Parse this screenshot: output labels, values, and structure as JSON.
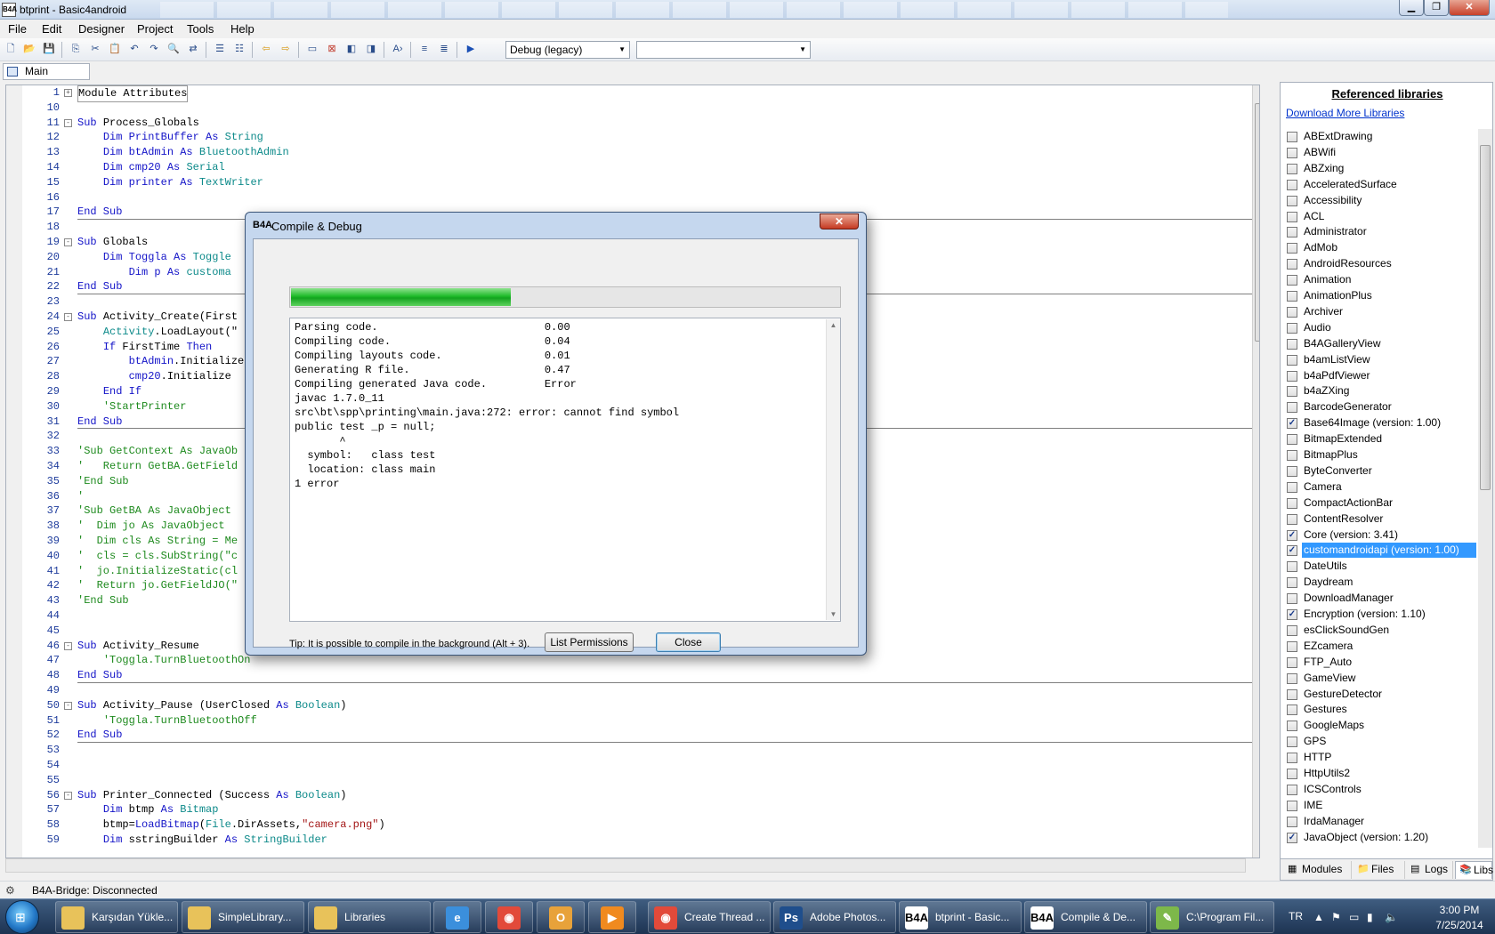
{
  "window": {
    "title": "btprint - Basic4android",
    "app_icon": "B4A"
  },
  "menu": [
    "File",
    "Edit",
    "Designer",
    "Project",
    "Tools",
    "Help"
  ],
  "toolbar": {
    "build_config": "Debug (legacy)",
    "device_combo": ""
  },
  "module_tab": "Main",
  "code": [
    {
      "n": "1",
      "tokens": [
        {
          "c": "plain",
          "t": "Module Attributes"
        }
      ],
      "fold": "+",
      "boxed": true
    },
    {
      "n": "10",
      "tokens": []
    },
    {
      "n": "11",
      "tokens": [
        {
          "c": "kw",
          "t": "Sub "
        },
        {
          "c": "plain",
          "t": "Process_Globals"
        }
      ],
      "fold": "-"
    },
    {
      "n": "12",
      "tokens": [
        {
          "c": "plain",
          "t": "    "
        },
        {
          "c": "kw",
          "t": "Dim "
        },
        {
          "c": "nm",
          "t": "PrintBuffer "
        },
        {
          "c": "kw",
          "t": "As "
        },
        {
          "c": "ty",
          "t": "String"
        }
      ]
    },
    {
      "n": "13",
      "tokens": [
        {
          "c": "plain",
          "t": "    "
        },
        {
          "c": "kw",
          "t": "Dim "
        },
        {
          "c": "nm",
          "t": "btAdmin "
        },
        {
          "c": "kw",
          "t": "As "
        },
        {
          "c": "ty",
          "t": "BluetoothAdmin"
        }
      ]
    },
    {
      "n": "14",
      "tokens": [
        {
          "c": "plain",
          "t": "    "
        },
        {
          "c": "kw",
          "t": "Dim "
        },
        {
          "c": "nm",
          "t": "cmp20 "
        },
        {
          "c": "kw",
          "t": "As "
        },
        {
          "c": "ty",
          "t": "Serial"
        }
      ]
    },
    {
      "n": "15",
      "tokens": [
        {
          "c": "plain",
          "t": "    "
        },
        {
          "c": "kw",
          "t": "Dim "
        },
        {
          "c": "nm",
          "t": "printer "
        },
        {
          "c": "kw",
          "t": "As "
        },
        {
          "c": "ty",
          "t": "TextWriter"
        }
      ]
    },
    {
      "n": "16",
      "tokens": []
    },
    {
      "n": "17",
      "tokens": [
        {
          "c": "kw",
          "t": "End Sub"
        }
      ]
    },
    {
      "n": "18",
      "tokens": []
    },
    {
      "n": "19",
      "tokens": [
        {
          "c": "kw",
          "t": "Sub "
        },
        {
          "c": "plain",
          "t": "Globals"
        }
      ],
      "fold": "-"
    },
    {
      "n": "20",
      "tokens": [
        {
          "c": "plain",
          "t": "    "
        },
        {
          "c": "kw",
          "t": "Dim "
        },
        {
          "c": "nm",
          "t": "Toggla "
        },
        {
          "c": "kw",
          "t": "As "
        },
        {
          "c": "ty",
          "t": "Toggle"
        }
      ]
    },
    {
      "n": "21",
      "tokens": [
        {
          "c": "plain",
          "t": "        "
        },
        {
          "c": "kw",
          "t": "Dim "
        },
        {
          "c": "nm",
          "t": "p "
        },
        {
          "c": "kw",
          "t": "As "
        },
        {
          "c": "ty",
          "t": "customa"
        }
      ]
    },
    {
      "n": "22",
      "tokens": [
        {
          "c": "kw",
          "t": "End Sub"
        }
      ]
    },
    {
      "n": "23",
      "tokens": []
    },
    {
      "n": "24",
      "tokens": [
        {
          "c": "kw",
          "t": "Sub "
        },
        {
          "c": "plain",
          "t": "Activity_Create(First"
        }
      ],
      "fold": "-"
    },
    {
      "n": "25",
      "tokens": [
        {
          "c": "plain",
          "t": "    "
        },
        {
          "c": "ty",
          "t": "Activity"
        },
        {
          "c": "plain",
          "t": ".LoadLayout(\""
        }
      ]
    },
    {
      "n": "26",
      "tokens": [
        {
          "c": "plain",
          "t": "    "
        },
        {
          "c": "kw",
          "t": "If "
        },
        {
          "c": "plain",
          "t": "FirstTime "
        },
        {
          "c": "kw",
          "t": "Then"
        }
      ]
    },
    {
      "n": "27",
      "tokens": [
        {
          "c": "plain",
          "t": "        "
        },
        {
          "c": "nm",
          "t": "btAdmin"
        },
        {
          "c": "plain",
          "t": ".Initialize"
        }
      ]
    },
    {
      "n": "28",
      "tokens": [
        {
          "c": "plain",
          "t": "        "
        },
        {
          "c": "nm",
          "t": "cmp20"
        },
        {
          "c": "plain",
          "t": ".Initialize"
        }
      ]
    },
    {
      "n": "29",
      "tokens": [
        {
          "c": "plain",
          "t": "    "
        },
        {
          "c": "kw",
          "t": "End If"
        }
      ]
    },
    {
      "n": "30",
      "tokens": [
        {
          "c": "plain",
          "t": "    "
        },
        {
          "c": "cm",
          "t": "'StartPrinter"
        }
      ]
    },
    {
      "n": "31",
      "tokens": [
        {
          "c": "kw",
          "t": "End Sub"
        }
      ]
    },
    {
      "n": "32",
      "tokens": []
    },
    {
      "n": "33",
      "tokens": [
        {
          "c": "cm",
          "t": "'Sub GetContext As JavaOb"
        }
      ]
    },
    {
      "n": "34",
      "tokens": [
        {
          "c": "cm",
          "t": "'   Return GetBA.GetField"
        }
      ]
    },
    {
      "n": "35",
      "tokens": [
        {
          "c": "cm",
          "t": "'End Sub"
        }
      ]
    },
    {
      "n": "36",
      "tokens": [
        {
          "c": "cm",
          "t": "'"
        }
      ]
    },
    {
      "n": "37",
      "tokens": [
        {
          "c": "cm",
          "t": "'Sub GetBA As JavaObject"
        }
      ]
    },
    {
      "n": "38",
      "tokens": [
        {
          "c": "cm",
          "t": "'  Dim jo As JavaObject"
        }
      ]
    },
    {
      "n": "39",
      "tokens": [
        {
          "c": "cm",
          "t": "'  Dim cls As String = Me"
        }
      ]
    },
    {
      "n": "40",
      "tokens": [
        {
          "c": "cm",
          "t": "'  cls = cls.SubString(\"c"
        }
      ]
    },
    {
      "n": "41",
      "tokens": [
        {
          "c": "cm",
          "t": "'  jo.InitializeStatic(cl"
        }
      ]
    },
    {
      "n": "42",
      "tokens": [
        {
          "c": "cm",
          "t": "'  Return jo.GetFieldJO(\""
        }
      ]
    },
    {
      "n": "43",
      "tokens": [
        {
          "c": "cm",
          "t": "'End Sub"
        }
      ]
    },
    {
      "n": "44",
      "tokens": []
    },
    {
      "n": "45",
      "tokens": []
    },
    {
      "n": "46",
      "tokens": [
        {
          "c": "kw",
          "t": "Sub "
        },
        {
          "c": "plain",
          "t": "Activity_Resume"
        }
      ],
      "fold": "-"
    },
    {
      "n": "47",
      "tokens": [
        {
          "c": "plain",
          "t": "    "
        },
        {
          "c": "cm",
          "t": "'Toggla.TurnBluetoothOn"
        }
      ]
    },
    {
      "n": "48",
      "tokens": [
        {
          "c": "kw",
          "t": "End Sub"
        }
      ]
    },
    {
      "n": "49",
      "tokens": []
    },
    {
      "n": "50",
      "tokens": [
        {
          "c": "kw",
          "t": "Sub "
        },
        {
          "c": "plain",
          "t": "Activity_Pause (UserClosed "
        },
        {
          "c": "kw",
          "t": "As "
        },
        {
          "c": "ty",
          "t": "Boolean"
        },
        {
          "c": "plain",
          "t": ")"
        }
      ],
      "fold": "-"
    },
    {
      "n": "51",
      "tokens": [
        {
          "c": "plain",
          "t": "    "
        },
        {
          "c": "cm",
          "t": "'Toggla.TurnBluetoothOff"
        }
      ]
    },
    {
      "n": "52",
      "tokens": [
        {
          "c": "kw",
          "t": "End Sub"
        }
      ]
    },
    {
      "n": "53",
      "tokens": []
    },
    {
      "n": "54",
      "tokens": []
    },
    {
      "n": "55",
      "tokens": []
    },
    {
      "n": "56",
      "tokens": [
        {
          "c": "kw",
          "t": "Sub "
        },
        {
          "c": "plain",
          "t": "Printer_Connected (Success "
        },
        {
          "c": "kw",
          "t": "As "
        },
        {
          "c": "ty",
          "t": "Boolean"
        },
        {
          "c": "plain",
          "t": ")"
        }
      ],
      "fold": "-"
    },
    {
      "n": "57",
      "tokens": [
        {
          "c": "plain",
          "t": "    "
        },
        {
          "c": "kw",
          "t": "Dim "
        },
        {
          "c": "plain",
          "t": "btmp "
        },
        {
          "c": "kw",
          "t": "As "
        },
        {
          "c": "ty",
          "t": "Bitmap"
        }
      ]
    },
    {
      "n": "58",
      "tokens": [
        {
          "c": "plain",
          "t": "    btmp="
        },
        {
          "c": "nm",
          "t": "LoadBitmap"
        },
        {
          "c": "plain",
          "t": "("
        },
        {
          "c": "ty",
          "t": "File"
        },
        {
          "c": "plain",
          "t": ".DirAssets,"
        },
        {
          "c": "st",
          "t": "\"camera.png\""
        },
        {
          "c": "plain",
          "t": ")"
        }
      ]
    },
    {
      "n": "59",
      "tokens": [
        {
          "c": "plain",
          "t": "    "
        },
        {
          "c": "kw",
          "t": "Dim "
        },
        {
          "c": "plain",
          "t": "sstringBuilder "
        },
        {
          "c": "kw",
          "t": "As "
        },
        {
          "c": "ty",
          "t": "StringBuilder"
        }
      ]
    }
  ],
  "dialog": {
    "icon": "B4A",
    "title": "Compile & Debug",
    "progress": 0.4,
    "log": [
      "Parsing code.                          0.00",
      "Compiling code.                        0.04",
      "Compiling layouts code.                0.01",
      "Generating R file.                     0.47",
      "Compiling generated Java code.         Error",
      "javac 1.7.0_11",
      "src\\bt\\spp\\printing\\main.java:272: error: cannot find symbol",
      "public test _p = null;",
      "       ^",
      "  symbol:   class test",
      "  location: class main",
      "1 error"
    ],
    "tip": "Tip: It is possible to compile in the background (Alt + 3).",
    "list_permissions_label": "List Permissions",
    "close_label": "Close"
  },
  "libraries": {
    "heading": "Referenced libraries",
    "download_link": "Download More Libraries",
    "items": [
      {
        "name": "ABExtDrawing",
        "checked": false
      },
      {
        "name": "ABWifi",
        "checked": false
      },
      {
        "name": "ABZxing",
        "checked": false
      },
      {
        "name": "AcceleratedSurface",
        "checked": false
      },
      {
        "name": "Accessibility",
        "checked": false
      },
      {
        "name": "ACL",
        "checked": false
      },
      {
        "name": "Administrator",
        "checked": false
      },
      {
        "name": "AdMob",
        "checked": false
      },
      {
        "name": "AndroidResources",
        "checked": false
      },
      {
        "name": "Animation",
        "checked": false
      },
      {
        "name": "AnimationPlus",
        "checked": false
      },
      {
        "name": "Archiver",
        "checked": false
      },
      {
        "name": "Audio",
        "checked": false
      },
      {
        "name": "B4AGalleryView",
        "checked": false
      },
      {
        "name": "b4amListView",
        "checked": false
      },
      {
        "name": "b4aPdfViewer",
        "checked": false
      },
      {
        "name": "b4aZXing",
        "checked": false
      },
      {
        "name": "BarcodeGenerator",
        "checked": false
      },
      {
        "name": "Base64Image (version: 1.00)",
        "checked": true
      },
      {
        "name": "BitmapExtended",
        "checked": false
      },
      {
        "name": "BitmapPlus",
        "checked": false
      },
      {
        "name": "ByteConverter",
        "checked": false
      },
      {
        "name": "Camera",
        "checked": false
      },
      {
        "name": "CompactActionBar",
        "checked": false
      },
      {
        "name": "ContentResolver",
        "checked": false
      },
      {
        "name": "Core (version: 3.41)",
        "checked": true
      },
      {
        "name": "customandroidapi (version: 1.00)",
        "checked": true,
        "selected": true
      },
      {
        "name": "DateUtils",
        "checked": false
      },
      {
        "name": "Daydream",
        "checked": false
      },
      {
        "name": "DownloadManager",
        "checked": false
      },
      {
        "name": "Encryption (version: 1.10)",
        "checked": true
      },
      {
        "name": "esClickSoundGen",
        "checked": false
      },
      {
        "name": "EZcamera",
        "checked": false
      },
      {
        "name": "FTP_Auto",
        "checked": false
      },
      {
        "name": "GameView",
        "checked": false
      },
      {
        "name": "GestureDetector",
        "checked": false
      },
      {
        "name": "Gestures",
        "checked": false
      },
      {
        "name": "GoogleMaps",
        "checked": false
      },
      {
        "name": "GPS",
        "checked": false
      },
      {
        "name": "HTTP",
        "checked": false
      },
      {
        "name": "HttpUtils2",
        "checked": false
      },
      {
        "name": "ICSControls",
        "checked": false
      },
      {
        "name": "IME",
        "checked": false
      },
      {
        "name": "IrdaManager",
        "checked": false
      },
      {
        "name": "JavaObject (version: 1.20)",
        "checked": true
      }
    ],
    "tabs": [
      "Modules",
      "Files",
      "Logs",
      "Libs"
    ]
  },
  "status": {
    "text": "B4A-Bridge: Disconnected"
  },
  "taskbar": {
    "tasks": [
      {
        "label": "Karşıdan Yükle...",
        "icon": "folder-icon",
        "color": "#e8c25a"
      },
      {
        "label": "SimpleLibrary...",
        "icon": "folder-icon",
        "color": "#e8c25a"
      },
      {
        "label": "Libraries",
        "icon": "folder-icon",
        "color": "#e8c25a"
      },
      {
        "label": "",
        "icon": "ie-icon",
        "color": "#3b8fdc",
        "glyph": "e"
      },
      {
        "label": "",
        "icon": "chrome-icon",
        "color": "#e24a3a",
        "glyph": "◉"
      },
      {
        "label": "",
        "icon": "outlook-icon",
        "color": "#e8a23a",
        "glyph": "O"
      },
      {
        "label": "",
        "icon": "media-player-icon",
        "color": "#f08a1f",
        "glyph": "▶"
      },
      {
        "label": "Create Thread ...",
        "icon": "chrome-icon",
        "color": "#e24a3a",
        "glyph": "◉"
      },
      {
        "label": "Adobe Photos...",
        "icon": "photoshop-icon",
        "color": "#1f4e8c",
        "glyph": "Ps"
      },
      {
        "label": "btprint - Basic...",
        "icon": "b4a-icon",
        "color": "#ffffff",
        "glyph": "B4A"
      },
      {
        "label": "Compile & De...",
        "icon": "b4a-icon",
        "color": "#ffffff",
        "glyph": "B4A"
      },
      {
        "label": "C:\\Program Fil...",
        "icon": "notepad-icon",
        "color": "#7db84a",
        "glyph": "✎"
      }
    ],
    "language": "TR",
    "time": "3:00 PM",
    "date": "7/25/2014"
  }
}
